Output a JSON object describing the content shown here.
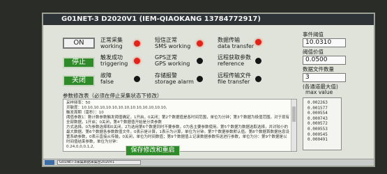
{
  "window": {
    "title": "G01NET-3 D2020V1 (IEM-QIAOKANG 13784772917)"
  },
  "buttons": {
    "on": "ON",
    "stop": "停止",
    "close": "关闭",
    "save": "保存修改和重启"
  },
  "indicators": [
    {
      "label": "正常采集",
      "sub": "working",
      "state": "red"
    },
    {
      "label": "短信正常",
      "sub": "SMS working",
      "state": "red"
    },
    {
      "label": "数据传输",
      "sub": "data transfer",
      "state": "red"
    },
    {
      "label": "触发成功",
      "sub": "triggering",
      "state": "red"
    },
    {
      "label": "GPS正常",
      "sub": "GPS working",
      "state": "black"
    },
    {
      "label": "远程获取参数",
      "sub": "reference",
      "state": "black"
    },
    {
      "label": "故障",
      "sub": "false",
      "state": "black"
    },
    {
      "label": "存储报警",
      "sub": "storage alarm",
      "state": "black"
    },
    {
      "label": "远程传输文件",
      "sub": "file transfer",
      "state": "black"
    }
  ],
  "right_panel": {
    "event_threshold_label": "事件阈值",
    "event_threshold_value": "10.0310",
    "sigma_label": "阈值价值",
    "sigma_value": "0.0500",
    "file_count_label": "数据文件数量",
    "file_count_value": "3",
    "maxval_label": "(各通道最大值)",
    "maxval_sub": "max value",
    "values": [
      "0.002263",
      "0.001577",
      "0.000554",
      "0.000743",
      "0.000572",
      "0.000553",
      "0.000545",
      "0.000491"
    ]
  },
  "params": {
    "title": "参数修改表（必须在停止采集状态下修改）",
    "lines": [
      "采样频率：50",
      "灵敏度：10.10,10.10,10.10,10.10,10.10,10.10,10.10,",
      "触发周期（毫秒）：10",
      "阈值参数1：数计数参数触发阈值确定，1开启，0关闭；第2个数据值是各时间范围，单位为分钟；第3个数据为极值范围，对于现有全部数据，1开启；0关闭，第4个数据值开始是分类参数",
      "方式选择。0为参数选择和0关闭，2为选用第6个数据同时不要参数，0为各主要参数使用。第5个数据为数据选取选择，并对较小的最大数据。第6个数据各参数数值文件，0表示是计算，1表示为计算，单位为分钟。第7个数据参数默认值。第8个数据首数据信息设置系统参数，0表示直接从传输，0关闭，单位为时间数值；第9个数据值上记录数据参数传送进行参数，单位为分：第9个数据是以时间值结束参数，单位为分钟：",
      "0.24,0,0,0,1,2,"
    ]
  },
  "taskbar": {
    "task_label": "G01NET-3采集数据采集台2020V1"
  }
}
